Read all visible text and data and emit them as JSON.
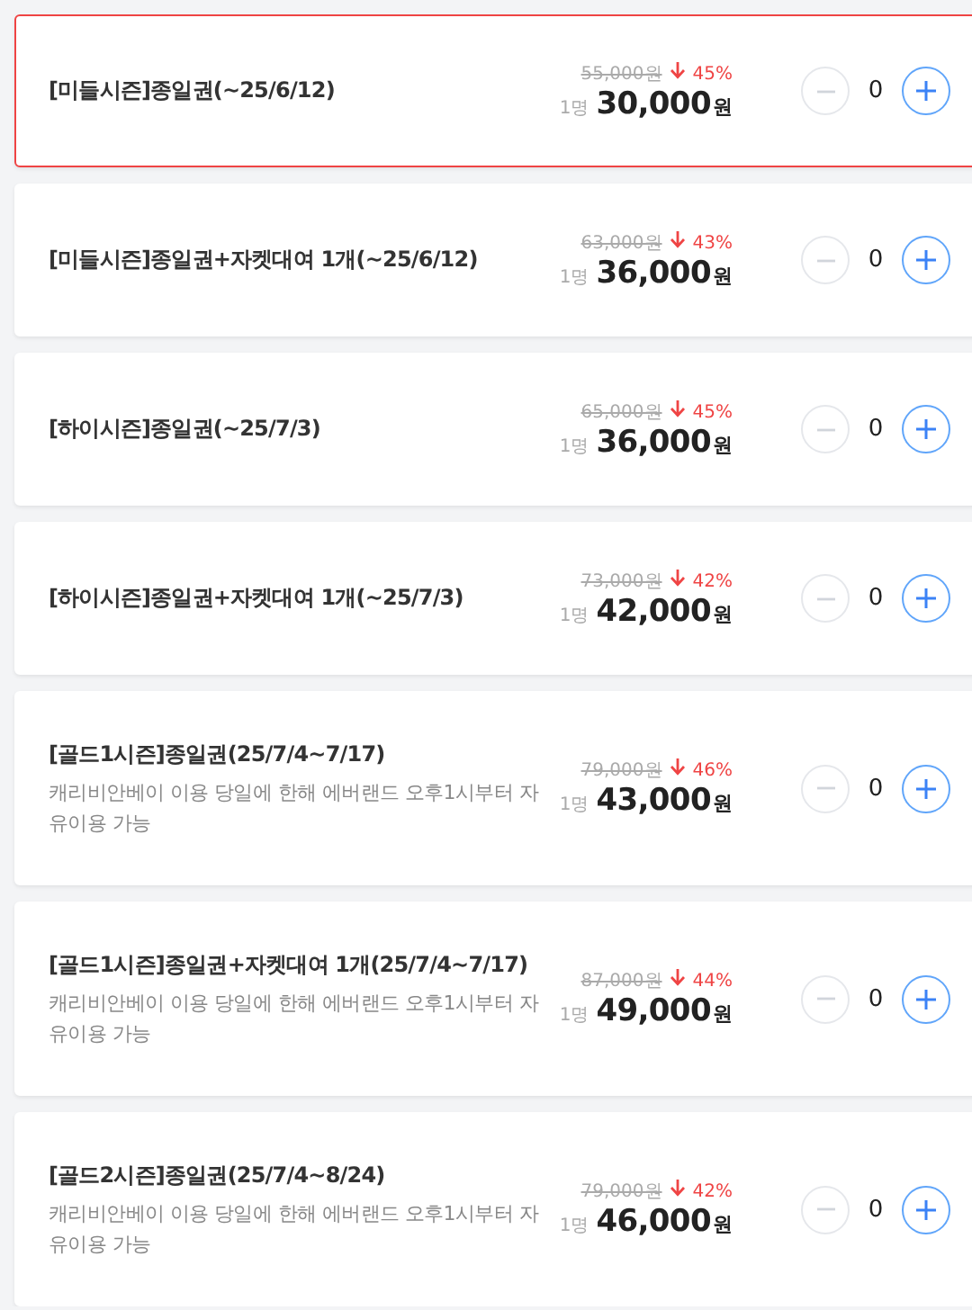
{
  "products": [
    {
      "title": "[미들시즌]종일권(~25/6/12)",
      "selected": true,
      "original_price": "55,000원",
      "discount": "45%",
      "unit": "1명",
      "price": "30,000",
      "currency": "원",
      "quantity": "0"
    },
    {
      "title": "[미들시즌]종일권+자켓대여 1개(~25/6/12)",
      "selected": false,
      "original_price": "63,000원",
      "discount": "43%",
      "unit": "1명",
      "price": "36,000",
      "currency": "원",
      "quantity": "0"
    },
    {
      "title": "[하이시즌]종일권(~25/7/3)",
      "selected": false,
      "original_price": "65,000원",
      "discount": "45%",
      "unit": "1명",
      "price": "36,000",
      "currency": "원",
      "quantity": "0"
    },
    {
      "title": "[하이시즌]종일권+자켓대여 1개(~25/7/3)",
      "selected": false,
      "original_price": "73,000원",
      "discount": "42%",
      "unit": "1명",
      "price": "42,000",
      "currency": "원",
      "quantity": "0"
    },
    {
      "title": "[골드1시즌]종일권(25/7/4~7/17)",
      "description": "캐리비안베이 이용 당일에 한해 에버랜드 오후1시부터 자유이용 가능",
      "selected": false,
      "original_price": "79,000원",
      "discount": "46%",
      "unit": "1명",
      "price": "43,000",
      "currency": "원",
      "quantity": "0"
    },
    {
      "title": "[골드1시즌]종일권+자켓대여 1개(25/7/4~7/17)",
      "description": "캐리비안베이 이용 당일에 한해 에버랜드 오후1시부터 자유이용 가능",
      "selected": false,
      "original_price": "87,000원",
      "discount": "44%",
      "unit": "1명",
      "price": "49,000",
      "currency": "원",
      "quantity": "0"
    },
    {
      "title": "[골드2시즌]종일권(25/7/4~8/24)",
      "description": "캐리비안베이 이용 당일에 한해 에버랜드 오후1시부터 자유이용 가능",
      "selected": false,
      "original_price": "79,000원",
      "discount": "42%",
      "unit": "1명",
      "price": "46,000",
      "currency": "원",
      "quantity": "0"
    }
  ]
}
